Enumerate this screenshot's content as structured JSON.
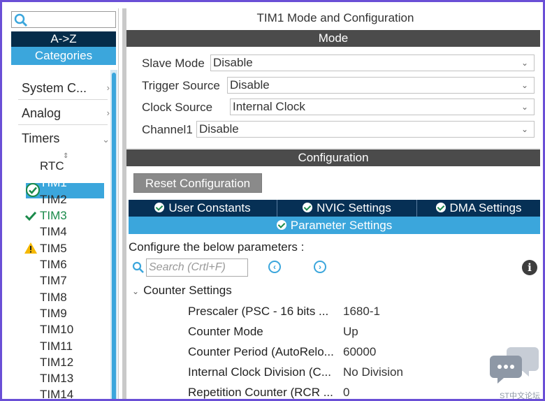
{
  "left": {
    "az_label": "A->Z",
    "categories_label": "Categories",
    "category_items": [
      {
        "label": "System C..."
      },
      {
        "label": "Analog"
      },
      {
        "label": "Timers"
      }
    ],
    "timers": [
      {
        "label": "RTC",
        "status": "none"
      },
      {
        "label": "TIM1",
        "status": "selected"
      },
      {
        "label": "TIM2",
        "status": "none"
      },
      {
        "label": "TIM3",
        "status": "ok"
      },
      {
        "label": "TIM4",
        "status": "none"
      },
      {
        "label": "TIM5",
        "status": "warning"
      },
      {
        "label": "TIM6",
        "status": "none"
      },
      {
        "label": "TIM7",
        "status": "none"
      },
      {
        "label": "TIM8",
        "status": "none"
      },
      {
        "label": "TIM9",
        "status": "none"
      },
      {
        "label": "TIM10",
        "status": "none"
      },
      {
        "label": "TIM11",
        "status": "none"
      },
      {
        "label": "TIM12",
        "status": "none"
      },
      {
        "label": "TIM13",
        "status": "none"
      },
      {
        "label": "TIM14",
        "status": "none"
      }
    ]
  },
  "right": {
    "title": "TIM1 Mode and Configuration",
    "mode_band": "Mode",
    "mode_fields": [
      {
        "label": "Slave Mode",
        "value": "Disable"
      },
      {
        "label": "Trigger Source",
        "value": "Disable"
      },
      {
        "label": "Clock Source",
        "value": "Internal Clock"
      },
      {
        "label": "Channel1",
        "value": "Disable"
      }
    ],
    "config_band": "Configuration",
    "reset_label": "Reset Configuration",
    "tabs": [
      "User Constants",
      "NVIC Settings",
      "DMA Settings"
    ],
    "active_tab": "Parameter Settings",
    "configure_text": "Configure the below parameters :",
    "search_placeholder": "Search (Crtl+F)",
    "section_label": "Counter Settings",
    "params": [
      {
        "label": "Prescaler (PSC - 16 bits ...",
        "value": "1680-1"
      },
      {
        "label": "Counter Mode",
        "value": "Up"
      },
      {
        "label": "Counter Period (AutoRelo...",
        "value": "60000"
      },
      {
        "label": "Internal Clock Division (C...",
        "value": "No Division"
      },
      {
        "label": "Repetition Counter (RCR ...",
        "value": "0"
      }
    ]
  },
  "watermark_text": "ST中文论坛",
  "colors": {
    "accent_blue": "#3ba6dc",
    "dark_navy": "#052c4a",
    "band_gray": "#4b4b4b",
    "ok_green": "#1a8a4a",
    "warn_yellow": "#f5b800",
    "frame": "#6a4fd6"
  }
}
